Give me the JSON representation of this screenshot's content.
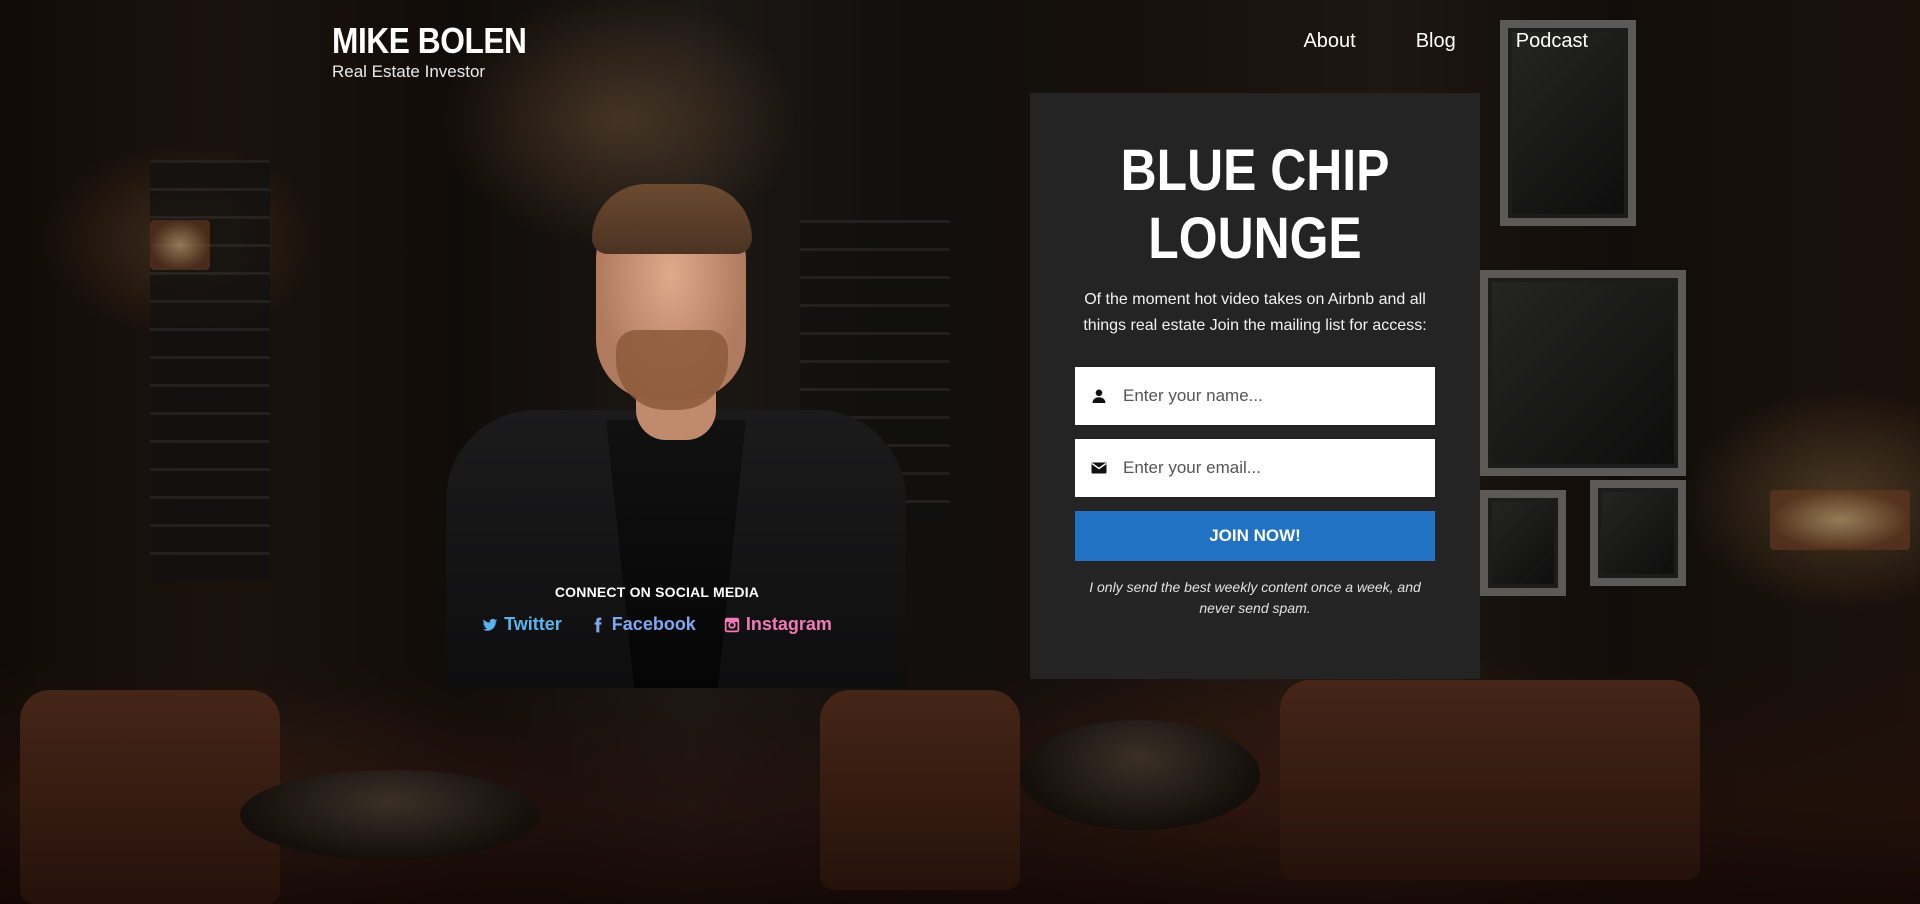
{
  "header": {
    "brand_name": "MIKE BOLEN",
    "brand_tagline": "Real Estate Investor",
    "nav": [
      {
        "label": "About"
      },
      {
        "label": "Blog"
      },
      {
        "label": "Podcast"
      }
    ]
  },
  "social": {
    "title": "CONNECT ON SOCIAL MEDIA",
    "links": [
      {
        "label": "Twitter",
        "icon": "twitter-icon",
        "color": "#58b3f0"
      },
      {
        "label": "Facebook",
        "icon": "facebook-icon",
        "color": "#7fa7f2"
      },
      {
        "label": "Instagram",
        "icon": "instagram-icon",
        "color": "#f07ab7"
      }
    ]
  },
  "signup": {
    "title_line1": "BLUE CHIP",
    "title_line2": "LOUNGE",
    "description": "Of the moment hot video takes on Airbnb and all things real estate Join the mailing list for access:",
    "name_placeholder": "Enter your name...",
    "email_placeholder": "Enter your email...",
    "button_label": "JOIN NOW!",
    "note": "I only send the best weekly content once a week, and never send spam.",
    "button_color": "#2272c3",
    "card_color": "#242424"
  }
}
